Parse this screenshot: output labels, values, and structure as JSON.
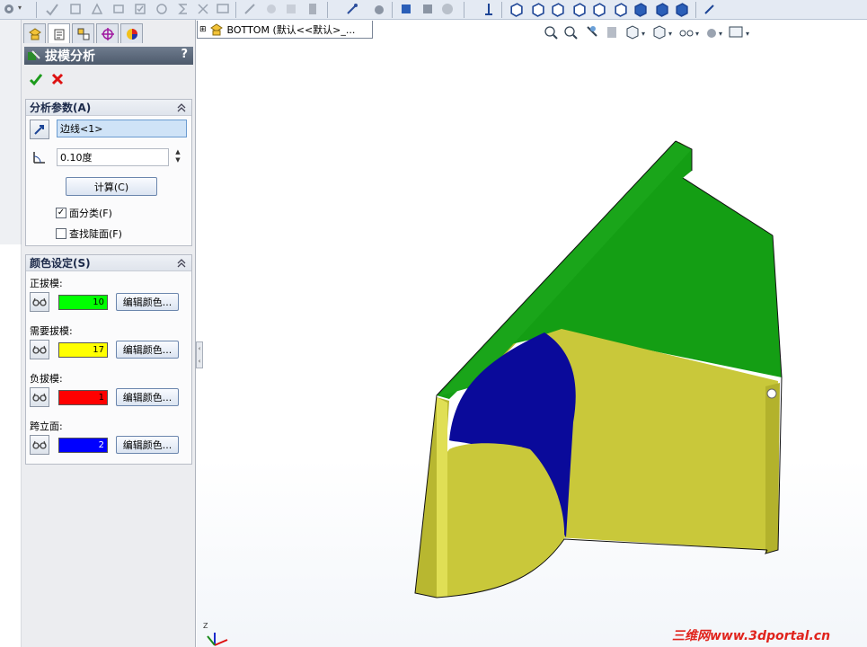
{
  "tree_tab": {
    "label": "BOTTOM  (默认<<默认>_..."
  },
  "panel": {
    "title": "拔模分析",
    "help": "?",
    "analysis_params": {
      "heading": "分析参数(A)",
      "selection": "边线<1>",
      "angle": "0.10度",
      "calc_button": "计算(C)",
      "face_classification": {
        "label": "面分类(F)",
        "checked": true
      },
      "find_steep_faces": {
        "label": "查找陡面(F)",
        "checked": false
      }
    },
    "color_settings": {
      "heading": "颜色设定(S)",
      "edit_label": "编辑颜色...",
      "items": [
        {
          "label": "正拔模:",
          "count": "10",
          "color": "#00ff00"
        },
        {
          "label": "需要拔模:",
          "count": "17",
          "color": "#ffff00"
        },
        {
          "label": "负拔模:",
          "count": "1",
          "color": "#ff0000"
        },
        {
          "label": "跨立面:",
          "count": "2",
          "color": "#0000ff"
        }
      ]
    }
  },
  "triad": {
    "z_label": "Z"
  },
  "watermark": "三维网www.3dportal.cn",
  "model_colors": {
    "green": "#149e14",
    "yellow": "#c9c83a",
    "blue": "#0a0a9a"
  }
}
